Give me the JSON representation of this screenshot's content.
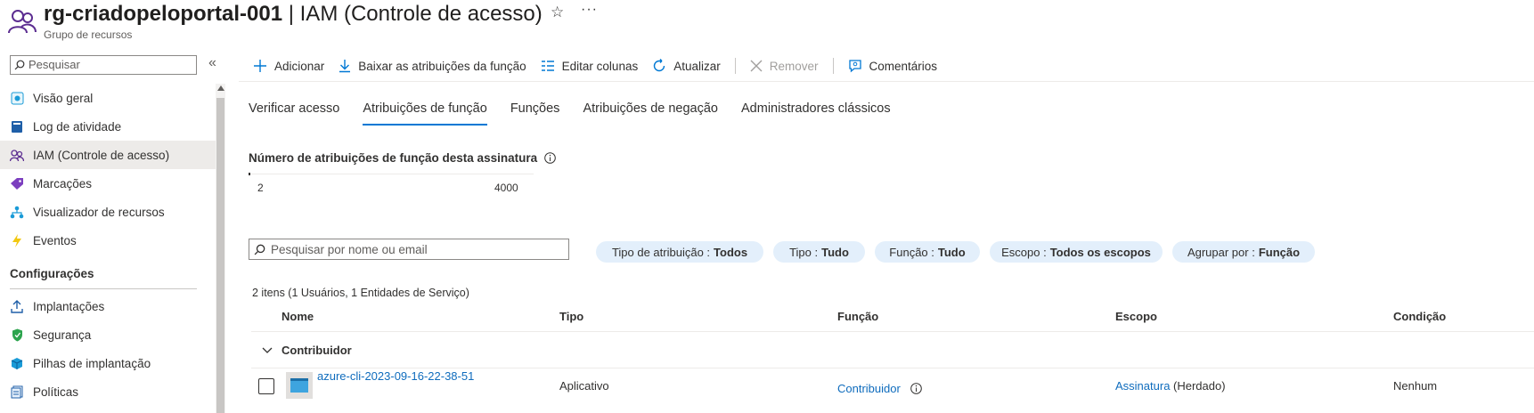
{
  "header": {
    "resource_name": "rg-criadopeloportal-001",
    "separator": " | ",
    "page": "IAM (Controle de acesso)",
    "subtitle": "Grupo de recursos",
    "star_glyph": "☆",
    "more_glyph": "···"
  },
  "sidebar": {
    "search_placeholder": "Pesquisar",
    "collapse_glyph": "«",
    "items": [
      {
        "label": "Visão geral",
        "icon": "overview-icon"
      },
      {
        "label": "Log de atividade",
        "icon": "activity-log-icon"
      },
      {
        "label": "IAM (Controle de acesso)",
        "icon": "iam-icon"
      },
      {
        "label": "Marcações",
        "icon": "tags-icon"
      },
      {
        "label": "Visualizador de recursos",
        "icon": "resource-visualizer-icon"
      },
      {
        "label": "Eventos",
        "icon": "events-icon"
      }
    ],
    "section": "Configurações",
    "settings_items": [
      {
        "label": "Implantações",
        "icon": "deployments-icon"
      },
      {
        "label": "Segurança",
        "icon": "security-icon"
      },
      {
        "label": "Pilhas de implantação",
        "icon": "deployment-stacks-icon"
      },
      {
        "label": "Políticas",
        "icon": "policies-icon"
      }
    ]
  },
  "toolbar": {
    "add": "Adicionar",
    "download": "Baixar as atribuições da função",
    "edit_columns": "Editar colunas",
    "refresh": "Atualizar",
    "remove": "Remover",
    "feedback": "Comentários"
  },
  "tabs": [
    "Verificar acesso",
    "Atribuições de função",
    "Funções",
    "Atribuições de negação",
    "Administradores clássicos"
  ],
  "active_tab": "Atribuições de função",
  "assignments": {
    "title": "Número de atribuições de função desta assinatura",
    "current": "2",
    "max": "4000",
    "usage_fraction": 0.0005
  },
  "filters": {
    "search_placeholder": "Pesquisar por nome ou email",
    "pills": [
      {
        "label": "Tipo de atribuição :",
        "value": "Todos"
      },
      {
        "label": "Tipo :",
        "value": "Tudo"
      },
      {
        "label": "Função :",
        "value": "Tudo"
      },
      {
        "label": "Escopo :",
        "value": "Todos os escopos"
      },
      {
        "label": "Agrupar por :",
        "value": "Função"
      }
    ]
  },
  "table": {
    "count": "2 itens (1 Usuários, 1 Entidades de Serviço)",
    "columns": [
      "Nome",
      "Tipo",
      "Função",
      "Escopo",
      "Condição"
    ],
    "group": "Contribuidor",
    "rows": [
      {
        "name": "azure-cli-2023-09-16-22-38-51",
        "type": "Aplicativo",
        "role": "Contribuidor",
        "scope_link": "Assinatura",
        "scope_suffix": " (Herdado)",
        "condition": "Nenhum"
      }
    ]
  },
  "colors": {
    "accent": "#0078d4",
    "link": "#0f6cbd",
    "pill": "#e3effb"
  }
}
